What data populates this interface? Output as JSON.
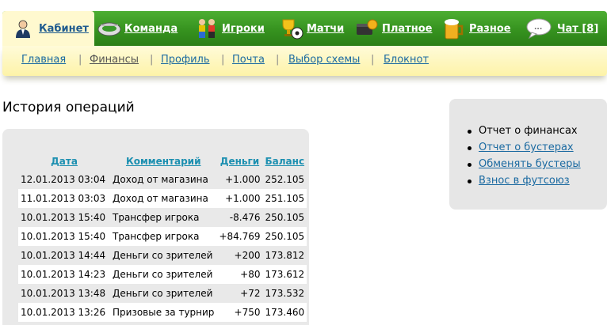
{
  "nav": {
    "tabs": [
      {
        "label": "Кабинет",
        "icon": "user-icon",
        "active": true
      },
      {
        "label": "Команда",
        "icon": "stadium-icon",
        "active": false
      },
      {
        "label": "Игроки",
        "icon": "players-icon",
        "active": false
      },
      {
        "label": "Матчи",
        "icon": "trophy-ball-icon",
        "active": false
      },
      {
        "label": "Платное",
        "icon": "wallet-coin-icon",
        "active": false
      },
      {
        "label": "Разное",
        "icon": "beer-mug-icon",
        "active": false
      },
      {
        "label": "Чат [8]",
        "icon": "chat-bubble-icon",
        "active": false
      }
    ],
    "accent": "#36921f"
  },
  "subnav": {
    "items": [
      {
        "label": "Главная",
        "current": false
      },
      {
        "label": "Финансы",
        "current": true
      },
      {
        "label": "Профиль",
        "current": false
      },
      {
        "label": "Почта",
        "current": false
      },
      {
        "label": "Выбор схемы",
        "current": false
      },
      {
        "label": "Блокнот",
        "current": false
      }
    ],
    "separator": "|"
  },
  "page": {
    "title": "История операций"
  },
  "table": {
    "columns": [
      "Дата",
      "Комментарий",
      "Деньги",
      "Баланс"
    ],
    "rows": [
      [
        "12.01.2013 03:04",
        "Доход от магазина",
        "+1.000",
        "252.105"
      ],
      [
        "11.01.2013 03:03",
        "Доход от магазина",
        "+1.000",
        "251.105"
      ],
      [
        "10.01.2013 15:40",
        "Трансфер игрока",
        "-8.476",
        "250.105"
      ],
      [
        "10.01.2013 15:40",
        "Трансфер игрока",
        "+84.769",
        "250.105"
      ],
      [
        "10.01.2013 14:44",
        "Деньги со зрителей",
        "+200",
        "173.812"
      ],
      [
        "10.01.2013 14:23",
        "Деньги со зрителей",
        "+80",
        "173.612"
      ],
      [
        "10.01.2013 13:48",
        "Деньги со зрителей",
        "+72",
        "173.532"
      ],
      [
        "10.01.2013 13:26",
        "Призовые за турнир",
        "+750",
        "173.460"
      ]
    ]
  },
  "sidebar": {
    "items": [
      {
        "label": "Отчет о финансах",
        "link": false
      },
      {
        "label": "Отчет о бустерах",
        "link": true
      },
      {
        "label": "Обменять бустеры",
        "link": true
      },
      {
        "label": "Взнос в футсоюз",
        "link": true
      }
    ]
  }
}
